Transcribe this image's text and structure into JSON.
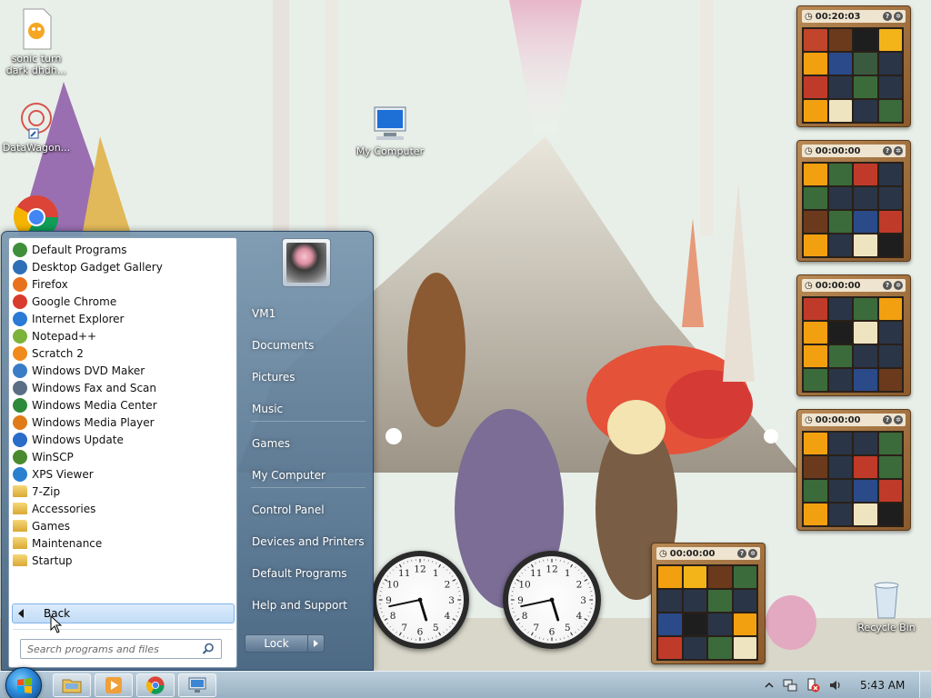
{
  "desktop_icons": [
    {
      "label": "sonic turn dark dhdh...",
      "icon": "scratch-file-icon"
    },
    {
      "label": "DataWagon...",
      "icon": "shortcut-icon"
    },
    {
      "label": "My Computer",
      "icon": "computer-icon"
    },
    {
      "label": "Recycle Bin",
      "icon": "recycle-bin-icon"
    }
  ],
  "gadgets": {
    "puzzles": [
      {
        "timer": "00:20:03"
      },
      {
        "timer": "00:00:00"
      },
      {
        "timer": "00:00:00"
      },
      {
        "timer": "00:00:00"
      },
      {
        "timer": "00:00:00"
      }
    ],
    "clock_numbers": [
      "12",
      "1",
      "2",
      "3",
      "4",
      "5",
      "6",
      "7",
      "8",
      "9",
      "10",
      "11"
    ]
  },
  "start_menu": {
    "programs": [
      {
        "label": "Default Programs",
        "icon": "default-programs-icon",
        "color": "#3f8f3a"
      },
      {
        "label": "Desktop Gadget Gallery",
        "icon": "gadget-gallery-icon",
        "color": "#2e6fb7"
      },
      {
        "label": "Firefox",
        "icon": "firefox-icon",
        "color": "#e8711e"
      },
      {
        "label": "Google Chrome",
        "icon": "chrome-icon",
        "color": "#d93b2f"
      },
      {
        "label": "Internet Explorer",
        "icon": "internet-explorer-icon",
        "color": "#2a7ad6"
      },
      {
        "label": "Notepad++",
        "icon": "notepadpp-icon",
        "color": "#7bb33b"
      },
      {
        "label": "Scratch 2",
        "icon": "scratch-icon",
        "color": "#f08a1c"
      },
      {
        "label": "Windows DVD Maker",
        "icon": "dvd-maker-icon",
        "color": "#3a7dc6"
      },
      {
        "label": "Windows Fax and Scan",
        "icon": "fax-scan-icon",
        "color": "#5a6f86"
      },
      {
        "label": "Windows Media Center",
        "icon": "media-center-icon",
        "color": "#2d8a3a"
      },
      {
        "label": "Windows Media Player",
        "icon": "media-player-icon",
        "color": "#e07b1a"
      },
      {
        "label": "Windows Update",
        "icon": "windows-update-icon",
        "color": "#2a6cc9"
      },
      {
        "label": "WinSCP",
        "icon": "winscp-icon",
        "color": "#4a8a2f"
      },
      {
        "label": "XPS Viewer",
        "icon": "xps-viewer-icon",
        "color": "#2b7fd0"
      },
      {
        "label": "7-Zip",
        "icon": "folder-icon",
        "color": "#e3b64a"
      },
      {
        "label": "Accessories",
        "icon": "folder-icon",
        "color": "#e3b64a"
      },
      {
        "label": "Games",
        "icon": "folder-icon",
        "color": "#e3b64a"
      },
      {
        "label": "Maintenance",
        "icon": "folder-icon",
        "color": "#e3b64a"
      },
      {
        "label": "Startup",
        "icon": "folder-icon",
        "color": "#e3b64a"
      }
    ],
    "back_label": "Back",
    "search_placeholder": "Search programs and files",
    "right_links": [
      {
        "label": "VM1",
        "name": "user-folder-link"
      },
      {
        "label": "Documents",
        "name": "documents-link"
      },
      {
        "label": "Pictures",
        "name": "pictures-link"
      },
      {
        "label": "Music",
        "name": "music-link"
      },
      {
        "label": "Games",
        "name": "games-link"
      },
      {
        "label": "My Computer",
        "name": "my-computer-link"
      },
      {
        "label": "Control Panel",
        "name": "control-panel-link"
      },
      {
        "label": "Devices and Printers",
        "name": "devices-printers-link"
      },
      {
        "label": "Default Programs",
        "name": "default-programs-link"
      },
      {
        "label": "Help and Support",
        "name": "help-support-link"
      }
    ],
    "lock_label": "Lock"
  },
  "taskbar": {
    "pinned": [
      "explorer-icon",
      "media-player-icon",
      "chrome-icon",
      "remote-desktop-icon"
    ],
    "tray_icons": [
      "show-hidden-icons-icon",
      "network-icon",
      "action-center-icon",
      "volume-icon"
    ],
    "time": "5:43 AM"
  }
}
